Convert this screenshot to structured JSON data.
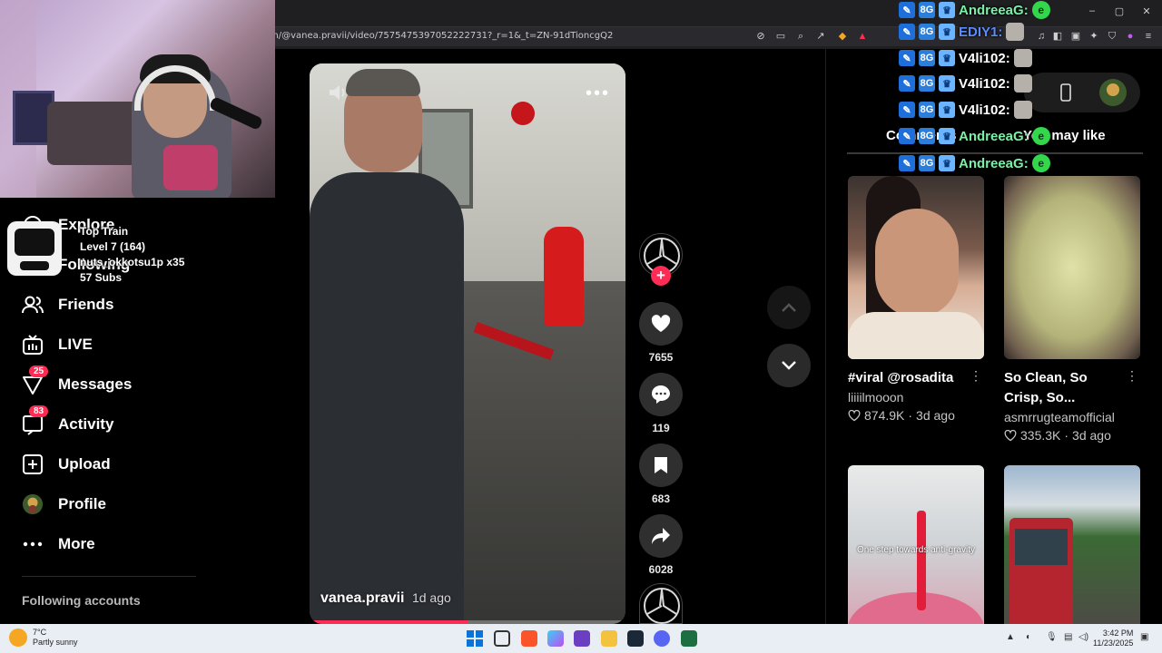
{
  "browser": {
    "url": "m/@vanea.pravii/video/7575475397052222731?_r=1&_t=ZN-91dTioncgQ2",
    "window_controls": [
      "–",
      "▢",
      "✕"
    ]
  },
  "overlay_train": {
    "line1": "Top Train",
    "line2": "Level 7  (164)",
    "line3": "nuts_okkotsu1p x35",
    "line4": "57 Subs"
  },
  "sidebar": {
    "items": [
      {
        "label": "Explore",
        "icon": "compass-icon"
      },
      {
        "label": "Following",
        "icon": "following-icon"
      },
      {
        "label": "Friends",
        "icon": "friends-icon"
      },
      {
        "label": "LIVE",
        "icon": "live-icon"
      },
      {
        "label": "Messages",
        "icon": "messages-icon",
        "badge": "25"
      },
      {
        "label": "Activity",
        "icon": "activity-icon",
        "badge": "83"
      },
      {
        "label": "Upload",
        "icon": "upload-icon"
      },
      {
        "label": "Profile",
        "icon": "avatar"
      },
      {
        "label": "More",
        "icon": "more-icon"
      }
    ],
    "following_title": "Following accounts"
  },
  "video": {
    "author": "vanea.pravii",
    "date": "1d ago",
    "progress": 0.5
  },
  "actions": {
    "likes": "7655",
    "comments": "119",
    "saves": "683",
    "shares": "6028"
  },
  "right_panel": {
    "tab_comments": "Comments",
    "tab_like": "You may like",
    "cards": [
      {
        "title": "#viral @rosadita",
        "user": "liiiilmooon",
        "likes": "874.9K",
        "date": "3d ago"
      },
      {
        "title": "So Clean, So Crisp, So...",
        "user": "asmrrugteamofficial",
        "likes": "335.3K",
        "date": "3d ago"
      },
      {
        "title": "",
        "caption": "One step towards anti-gravity",
        "user": "",
        "likes": "",
        "date": ""
      },
      {
        "title": "",
        "user": "",
        "likes": "",
        "date": ""
      }
    ]
  },
  "chat": [
    {
      "name": "AndreeaG:",
      "color": "#7cf0a9"
    },
    {
      "name": "EDIY1:",
      "color": "#5b8cff"
    },
    {
      "name": "V4li102:",
      "color": "#ffffff"
    },
    {
      "name": "V4li102:",
      "color": "#ffffff"
    },
    {
      "name": "V4li102:",
      "color": "#ffffff"
    },
    {
      "name": "AndreeaG:",
      "color": "#7cf0a9"
    },
    {
      "name": "AndreeaG:",
      "color": "#7cf0a9"
    }
  ],
  "taskbar": {
    "temp": "7°C",
    "weather": "Partly sunny",
    "time": "3:42 PM",
    "date": "11/23/2025"
  },
  "colors": {
    "accent": "#fe2c55",
    "chat_green": "#7cf0a9"
  }
}
